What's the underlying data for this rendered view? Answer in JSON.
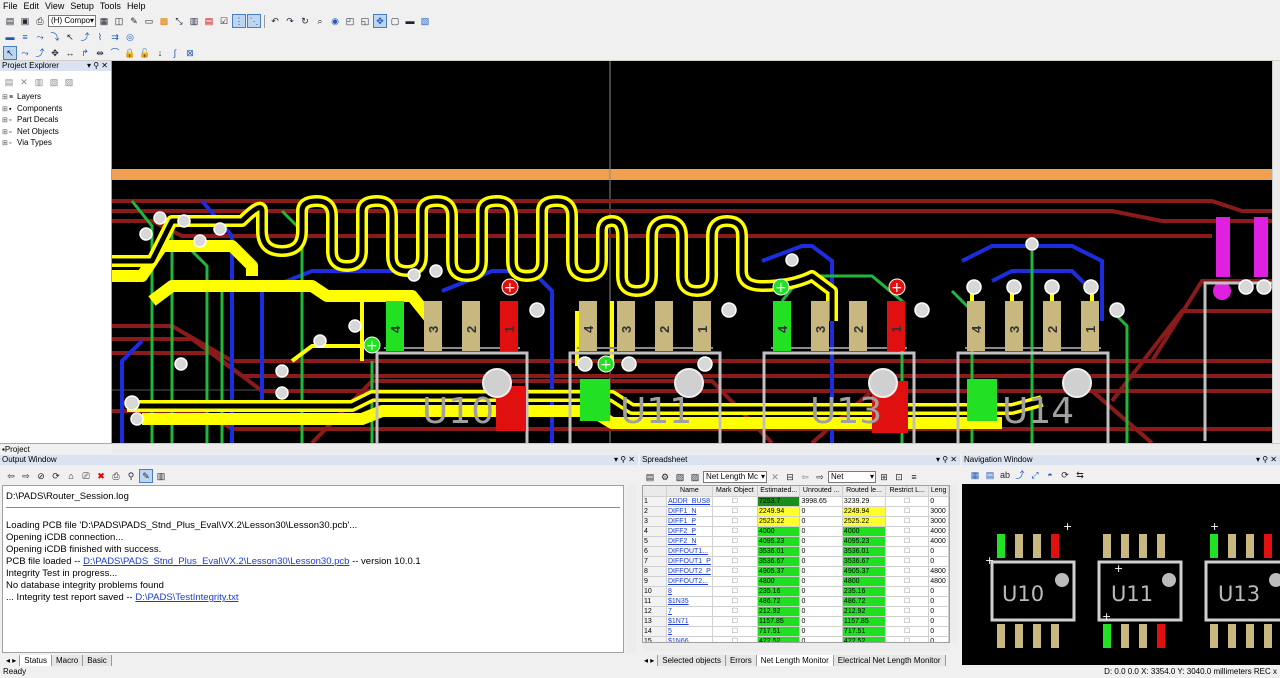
{
  "menu": [
    "File",
    "Edit",
    "View",
    "Setup",
    "Tools",
    "Help"
  ],
  "toolbar": {
    "layer_combo": "(H) Compo"
  },
  "project_explorer": {
    "title": "Project Explorer",
    "items": [
      "Layers",
      "Components",
      "Part Decals",
      "Net Objects",
      "Via Types"
    ],
    "tab": "Project"
  },
  "board": {
    "components": [
      "U10",
      "U11",
      "U13",
      "U14"
    ],
    "pin_labels": {
      "u10": [
        "4",
        "3",
        "2",
        "1"
      ],
      "u11": [
        "4",
        "3",
        "2",
        "1"
      ],
      "u13": [
        "4",
        "3",
        "2",
        "1"
      ],
      "u14": [
        "4",
        "3",
        "2",
        "1"
      ]
    },
    "colors": {
      "background": "#000000",
      "yellow": "#ffff00",
      "dark_red": "#8b1a1a",
      "green": "#1fb83a",
      "blue": "#1c2de0",
      "orange": "#f0a050",
      "magenta": "#e020e0",
      "pad_tan": "#c8b880",
      "red_pad": "#e01010",
      "pad_green": "#22e022",
      "white": "#ffffff"
    }
  },
  "output_window": {
    "title": "Output Window",
    "log_file": "D:\\PADS\\Router_Session.log",
    "lines": [
      {
        "text": "Loading PCB file 'D:\\PADS\\PADS_Stnd_Plus_Eval\\VX.2\\Lesson30\\Lesson30.pcb'..."
      },
      {
        "text": "Opening iCDB connection..."
      },
      {
        "text": "Opening iCDB finished with success."
      },
      {
        "pre": "PCB file loaded -- ",
        "link": "D:\\PADS\\PADS_Stnd_Plus_Eval\\VX.2\\Lesson30\\Lesson30.pcb",
        "post": " -- version 10.0.1"
      },
      {
        "text": "Integrity Test in progress..."
      },
      {
        "text": "No database integrity problems found"
      },
      {
        "pre": "... Integrity test report saved -- ",
        "link": "D:\\PADS\\TestIntegrity.txt",
        "post": ""
      }
    ],
    "tabs": [
      "Status",
      "Macro",
      "Basic"
    ]
  },
  "spreadsheet": {
    "title": "Spreadsheet",
    "combo1": "Net Length Mc",
    "combo2": "Net",
    "columns": [
      "",
      "Name",
      "Mark Object",
      "Estimated...",
      "Unrouted ...",
      "Routed le...",
      "Restrict L...",
      "Leng"
    ],
    "rows": [
      {
        "n": "1",
        "name": "ADDR_BUS8",
        "est": "7253.7",
        "unr": "3998.65",
        "routed": "3239.29",
        "len": "0",
        "c": [
          "dg",
          "",
          ""
        ]
      },
      {
        "n": "2",
        "name": "DIFF1_N",
        "est": "2249.94",
        "unr": "0",
        "routed": "2249.94",
        "len": "3000",
        "c": [
          "y",
          "g",
          "y"
        ]
      },
      {
        "n": "3",
        "name": "DIFF1_P",
        "est": "2525.22",
        "unr": "0",
        "routed": "2525.22",
        "len": "3000",
        "c": [
          "y",
          "g",
          "y"
        ]
      },
      {
        "n": "4",
        "name": "DIFF2_P",
        "est": "4000",
        "unr": "0",
        "routed": "4000",
        "len": "4000",
        "c": [
          "g",
          "g",
          "g"
        ]
      },
      {
        "n": "5",
        "name": "DIFF2_N",
        "est": "4095.23",
        "unr": "0",
        "routed": "4095.23",
        "len": "4000",
        "c": [
          "g",
          "g",
          "g"
        ]
      },
      {
        "n": "6",
        "name": "DIFFOUT1...",
        "est": "3536.01",
        "unr": "0",
        "routed": "3536.01",
        "len": "0",
        "c": [
          "g",
          "g",
          "g"
        ]
      },
      {
        "n": "7",
        "name": "DIFFOUT1_P",
        "est": "3536.67",
        "unr": "0",
        "routed": "3536.67",
        "len": "0",
        "c": [
          "g",
          "g",
          "g"
        ]
      },
      {
        "n": "8",
        "name": "DIFFOUT2_P",
        "est": "4905.37",
        "unr": "0",
        "routed": "4905.37",
        "len": "4800",
        "c": [
          "g",
          "g",
          "g"
        ]
      },
      {
        "n": "9",
        "name": "DIFFOUT2...",
        "est": "4800",
        "unr": "0",
        "routed": "4800",
        "len": "4800",
        "c": [
          "g",
          "g",
          "g"
        ]
      },
      {
        "n": "10",
        "name": "8",
        "est": "235.16",
        "unr": "0",
        "routed": "235.16",
        "len": "0",
        "c": [
          "g",
          "g",
          "g"
        ]
      },
      {
        "n": "11",
        "name": "$1N35",
        "est": "486.72",
        "unr": "0",
        "routed": "486.72",
        "len": "0",
        "c": [
          "g",
          "g",
          "g"
        ]
      },
      {
        "n": "12",
        "name": "7",
        "est": "212.92",
        "unr": "0",
        "routed": "212.92",
        "len": "0",
        "c": [
          "g",
          "g",
          "g"
        ]
      },
      {
        "n": "13",
        "name": "$1N71",
        "est": "1157.85",
        "unr": "0",
        "routed": "1157.85",
        "len": "0",
        "c": [
          "g",
          "g",
          "g"
        ]
      },
      {
        "n": "14",
        "name": "5",
        "est": "717.51",
        "unr": "0",
        "routed": "717.51",
        "len": "0",
        "c": [
          "g",
          "g",
          "g"
        ]
      },
      {
        "n": "15",
        "name": "$1N66",
        "est": "422.52",
        "unr": "0",
        "routed": "422.52",
        "len": "0",
        "c": [
          "g",
          "g",
          "g"
        ]
      }
    ],
    "tabs": [
      "Selected objects",
      "Errors",
      "Net Length Monitor",
      "Electrical Net Length Monitor"
    ]
  },
  "navigation": {
    "title": "Navigation Window",
    "components": [
      "U10",
      "U11",
      "U13"
    ]
  },
  "status": {
    "left": "Ready",
    "right": "D: 0.0 0.0 X: 3354.0  Y: 3040.0 millimeters REC x"
  }
}
